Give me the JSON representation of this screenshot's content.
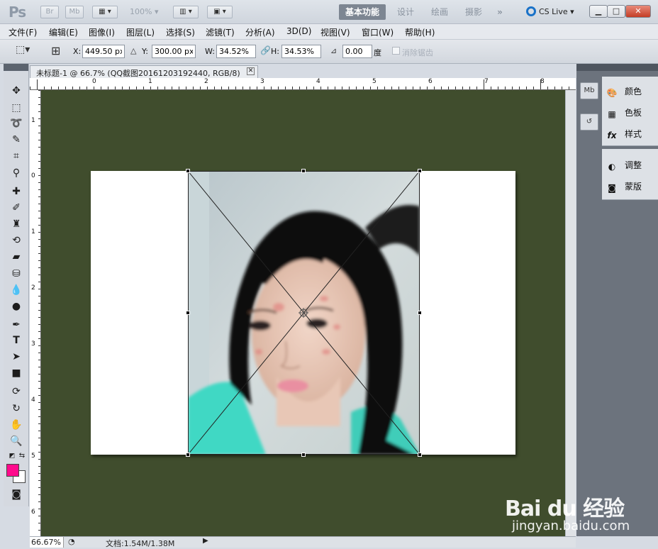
{
  "app": {
    "logo": "Ps",
    "bridge_btn": "Br",
    "mini_bridge_btn": "Mb",
    "zoom_level": "100%",
    "workspaces": [
      "基本功能",
      "设计",
      "绘画",
      "摄影"
    ],
    "more": "»",
    "cs_live": "CS Live"
  },
  "menu": [
    "文件(F)",
    "编辑(E)",
    "图像(I)",
    "图层(L)",
    "选择(S)",
    "滤镜(T)",
    "分析(A)",
    "3D(D)",
    "视图(V)",
    "窗口(W)",
    "帮助(H)"
  ],
  "options": {
    "x_label": "X:",
    "x_value": "449.50 px",
    "y_label": "Y:",
    "y_value": "300.00 px",
    "w_label": "W:",
    "w_value": "34.52%",
    "h_label": "H:",
    "h_value": "34.53%",
    "angle_value": "0.00",
    "angle_unit": "度",
    "antialias_label": "消除锯齿"
  },
  "document": {
    "tab_title": "未标题-1 @ 66.7% (QQ截图20161203192440, RGB/8)",
    "ruler_top": [
      "0",
      "1",
      "2",
      "3",
      "4",
      "5",
      "6",
      "7",
      "8"
    ],
    "ruler_left": [
      "1",
      "0",
      "1",
      "2",
      "3",
      "4",
      "5",
      "6"
    ],
    "canvas_color": "#404d2d",
    "fg_color": "#ff0a8c",
    "bg_color": "#ffffff"
  },
  "status": {
    "zoom": "66.67%",
    "doc_info": "文档:1.54M/1.38M"
  },
  "panels": {
    "group1": [
      "颜色",
      "色板",
      "样式"
    ],
    "group2": [
      "调整",
      "蒙版"
    ],
    "mini_bridge": "Mb"
  },
  "watermark": {
    "logo": "Bai du 经验",
    "url": "jingyan.baidu.com"
  }
}
